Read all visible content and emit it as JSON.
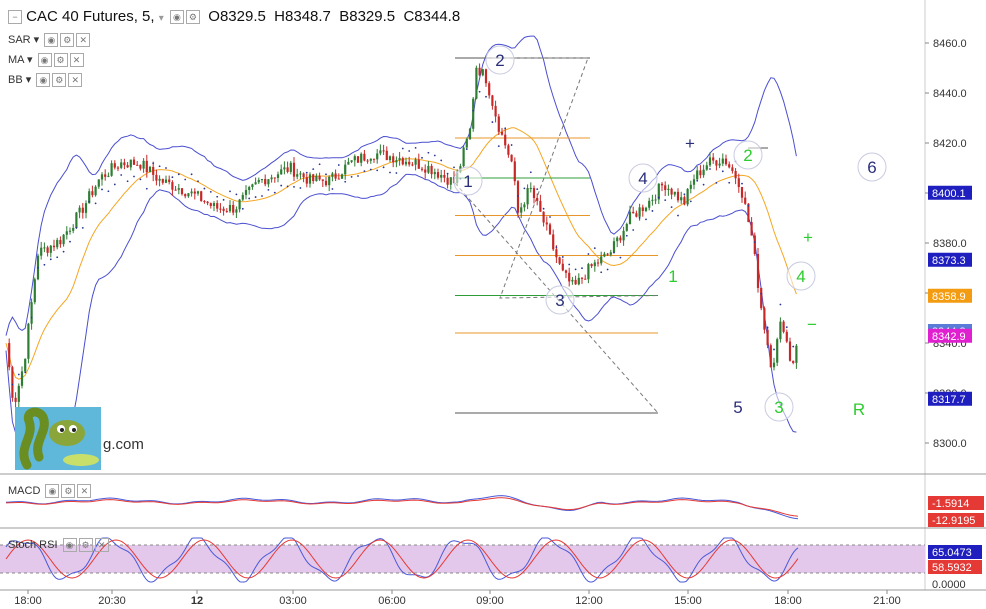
{
  "header": {
    "symbol": "CAC 40 Futures, 5,",
    "open": "O8329.5",
    "high": "H8348.7",
    "low": "B8329.5",
    "close": "C8344.8"
  },
  "indicators": [
    "SAR",
    "MA",
    "BB"
  ],
  "macd_label": "MACD",
  "stoch_label": "Stoch RSI",
  "logo_text": "g.com",
  "colors": {
    "candle_up": "#2e7d32",
    "candle_down": "#c62828",
    "bb": "#4a4fcf",
    "ma": "#f5a623",
    "sar": "#283593",
    "fib_orange": "#e8962b",
    "fib_green": "#2e9e3a",
    "wave_navy": "#2b2f7a",
    "wave_green": "#2ecc2e",
    "stoch_band": "#e4c8ec"
  },
  "chart_data": {
    "type": "candlestick",
    "y_axis": {
      "ticks": [
        8300,
        8320,
        8340,
        8360,
        8380,
        8400,
        8420,
        8440,
        8460
      ],
      "tick_labels": [
        "8300.0",
        "8320.0",
        "8340.0",
        "8360.0",
        "8380.0",
        "8400.0",
        "8420.0",
        "8440.0",
        "8460.0"
      ]
    },
    "x_axis": {
      "ticks": [
        "18:00",
        "20:30",
        "12",
        "03:00",
        "06:00",
        "09:00",
        "12:00",
        "15:00",
        "18:00",
        "21:00"
      ]
    },
    "price_badges": [
      {
        "value": "8400.1",
        "price": 8400.1,
        "color": "#1f1fbf"
      },
      {
        "value": "8373.3",
        "price": 8373.3,
        "color": "#1f1fbf"
      },
      {
        "value": "8358.9",
        "price": 8358.9,
        "color": "#f39c12"
      },
      {
        "value": "8344.8",
        "price": 8344.8,
        "color": "#5b7bd8"
      },
      {
        "value": "8342.9",
        "price": 8342.9,
        "color": "#e020d0"
      },
      {
        "value": "8317.7",
        "price": 8317.7,
        "color": "#1f1fbf"
      }
    ],
    "key_prices": [
      {
        "label": "2",
        "price": 8454
      },
      {
        "label": "1",
        "price": 8402
      },
      {
        "label": "4",
        "price": 8406
      },
      {
        "label": "3",
        "price": 8358
      },
      {
        "label": "2",
        "price": 8418
      },
      {
        "label": "4",
        "price": 8367
      },
      {
        "label": "5",
        "price": 8315
      },
      {
        "label": "3",
        "price": 8315
      }
    ],
    "wave_labels": [
      {
        "text": "2",
        "style": "navy"
      },
      {
        "text": "1",
        "style": "navy"
      },
      {
        "text": "3",
        "style": "navy"
      },
      {
        "text": "4",
        "style": "navy"
      },
      {
        "text": "6",
        "style": "navy"
      },
      {
        "text": "5",
        "style": "navy"
      },
      {
        "text": "2",
        "style": "green"
      },
      {
        "text": "1",
        "style": "green"
      },
      {
        "text": "4",
        "style": "green"
      },
      {
        "text": "3",
        "style": "green"
      },
      {
        "text": "R",
        "style": "green"
      },
      {
        "text": "+",
        "style": "green"
      },
      {
        "text": "−",
        "style": "green"
      },
      {
        "text": "+",
        "style": "navy"
      }
    ],
    "macd": {
      "badges": [
        {
          "value": "-1.5914",
          "color": "#e53935"
        },
        {
          "value": "-12.9195",
          "color": "#e53935"
        }
      ]
    },
    "stoch_rsi": {
      "badges": [
        {
          "value": "65.0473",
          "color": "#1f1fbf"
        },
        {
          "value": "58.5932",
          "color": "#e53935"
        },
        {
          "value": "0.0000",
          "color": ""
        }
      ]
    }
  }
}
